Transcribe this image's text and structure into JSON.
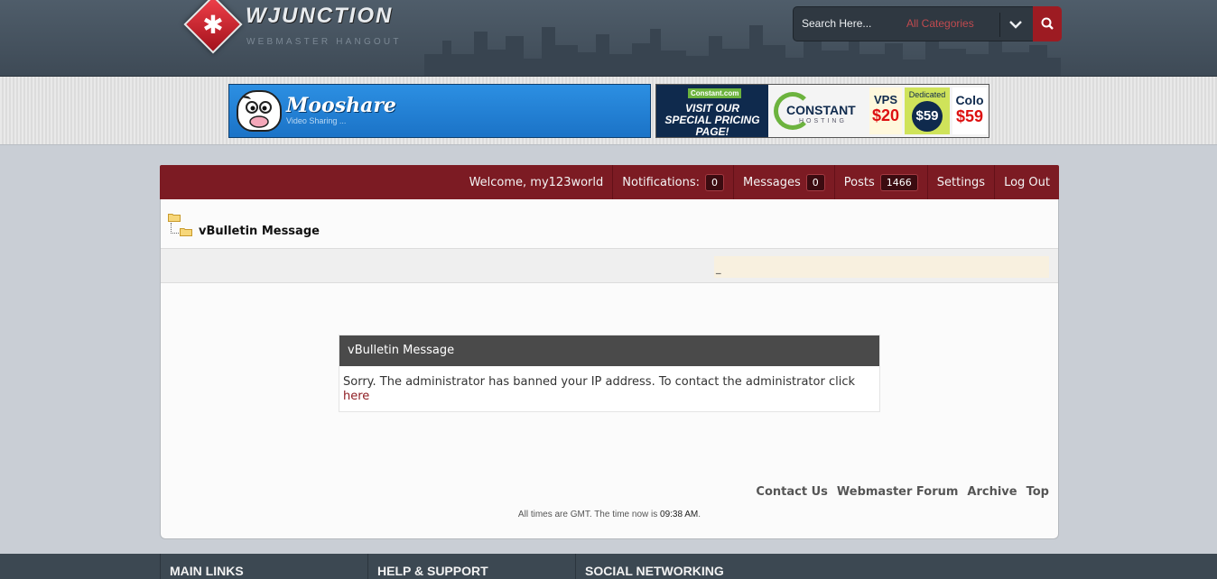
{
  "header": {
    "logo_text": "WJUNCTION",
    "logo_sub": "WEBMASTER HANGOUT",
    "search_placeholder": "Search Here...",
    "search_category": "All Categories"
  },
  "ads": {
    "ad1": {
      "title": "Mooshare",
      "subtitle": "Video Sharing ..."
    },
    "ad2": {
      "badge": "Constant.com",
      "visit": "VISIT OUR SPECIAL PRICING PAGE!",
      "brand": "CONSTANT",
      "brand_sub": "HOSTING",
      "vps_label": "VPS",
      "vps_price": "$20",
      "ded_label": "Dedicated",
      "ded_price": "$59",
      "colo_label": "Colo",
      "colo_price": "$59"
    }
  },
  "nav": {
    "welcome": "Welcome, my123world",
    "notifications_label": "Notifications:",
    "notifications_count": "0",
    "messages_label": "Messages",
    "messages_count": "0",
    "posts_label": "Posts",
    "posts_count": "1466",
    "settings_label": "Settings",
    "logout_label": "Log Out"
  },
  "breadcrumb": {
    "title": "vBulletin Message"
  },
  "subbar": {
    "mark": "_"
  },
  "message": {
    "title": "vBulletin Message",
    "body": "Sorry. The administrator has banned your IP address. To contact the administrator click",
    "link": "here"
  },
  "footer_links": [
    "Contact Us",
    "Webmaster Forum",
    "Archive",
    "Top"
  ],
  "time": {
    "prefix": "All times are GMT. The time now is",
    "value": "09:38 AM",
    "suffix": "."
  },
  "footer": {
    "col1": "MAIN LINKS",
    "col2": "HELP & SUPPORT",
    "col3": "SOCIAL NETWORKING"
  },
  "colors": {
    "accent": "#7c1b23",
    "header_bg": "#45525e",
    "link": "#8e1c22"
  }
}
